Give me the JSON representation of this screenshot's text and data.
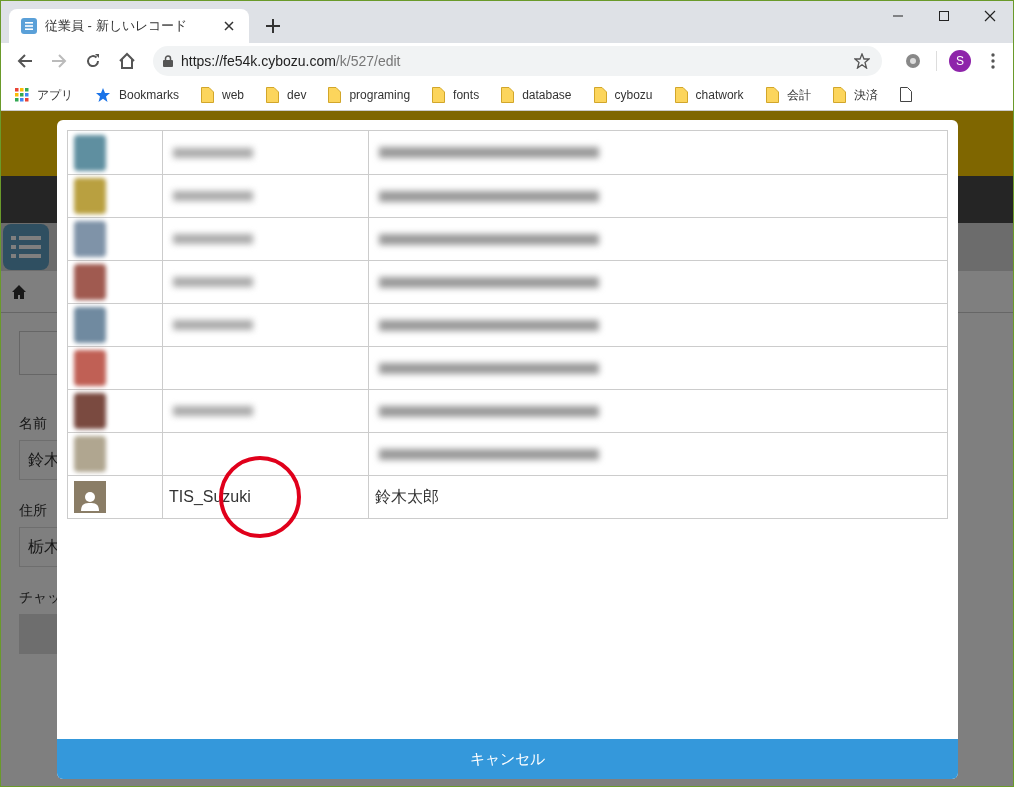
{
  "browser": {
    "tab_title": "従業員 - 新しいレコード",
    "url_host": "https://fe54k.cybozu.com",
    "url_path": "/k/527/edit",
    "profile_initial": "S",
    "bookmarks": [
      {
        "kind": "apps",
        "label": "アプリ"
      },
      {
        "kind": "star",
        "label": "Bookmarks"
      },
      {
        "kind": "folder",
        "label": "web"
      },
      {
        "kind": "folder",
        "label": "dev"
      },
      {
        "kind": "folder",
        "label": "programing"
      },
      {
        "kind": "folder",
        "label": "fonts"
      },
      {
        "kind": "folder",
        "label": "database"
      },
      {
        "kind": "folder",
        "label": "cybozu"
      },
      {
        "kind": "folder",
        "label": "chatwork"
      },
      {
        "kind": "folder",
        "label": "会計"
      },
      {
        "kind": "folder",
        "label": "決済"
      },
      {
        "kind": "page"
      }
    ]
  },
  "background_form": {
    "fields": [
      {
        "label": "名前",
        "value": "鈴木"
      },
      {
        "label": "住所",
        "value": "栃木"
      },
      {
        "label": "チャッ"
      }
    ]
  },
  "dialog": {
    "rows": [
      {
        "kind": "blurred",
        "color": "#5f8fa0",
        "login_shown": true
      },
      {
        "kind": "blurred",
        "color": "#b9a040",
        "login_shown": true
      },
      {
        "kind": "blurred",
        "color": "#7f93a8",
        "login_shown": true
      },
      {
        "kind": "blurred",
        "color": "#a05a50",
        "login_shown": true
      },
      {
        "kind": "blurred",
        "color": "#708aa0",
        "login_shown": true
      },
      {
        "kind": "blurred",
        "color": "#c06055",
        "login_shown": false
      },
      {
        "kind": "blurred",
        "color": "#7a4a40",
        "login_shown": true
      },
      {
        "kind": "blurred",
        "color": "#b0a690",
        "login_shown": false
      },
      {
        "kind": "user",
        "login": "TIS_Suzuki",
        "name": "鈴木太郎",
        "highlighted": true
      }
    ],
    "cancel_label": "キャンセル"
  }
}
